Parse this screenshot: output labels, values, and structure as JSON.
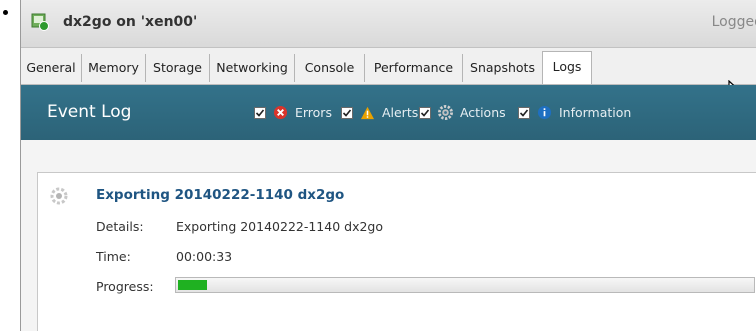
{
  "window": {
    "title": "dx2go on 'xen00'",
    "logged_in_text": "Logged"
  },
  "tabs": [
    {
      "label": "General"
    },
    {
      "label": "Memory"
    },
    {
      "label": "Storage"
    },
    {
      "label": "Networking"
    },
    {
      "label": "Console"
    },
    {
      "label": "Performance"
    },
    {
      "label": "Snapshots"
    },
    {
      "label": "Logs",
      "active": true
    }
  ],
  "event_log": {
    "title": "Event Log",
    "filters": [
      {
        "label": "Errors",
        "checked": true,
        "icon": "error-icon",
        "color": "#d9342b"
      },
      {
        "label": "Alerts",
        "checked": true,
        "icon": "alert-icon",
        "color": "#e8a100"
      },
      {
        "label": "Actions",
        "checked": true,
        "icon": "gear-icon",
        "color": "#c0c0c0"
      },
      {
        "label": "Information",
        "checked": true,
        "icon": "info-icon",
        "color": "#1e6fc1"
      }
    ]
  },
  "event": {
    "title": "Exporting 20140222-1140 dx2go",
    "details_label": "Details:",
    "details_value": "Exporting 20140222-1140 dx2go",
    "time_label": "Time:",
    "time_value": "00:00:33",
    "progress_label": "Progress:",
    "progress_fraction": 0.05
  },
  "colors": {
    "header_bar": "#2f6b82",
    "progress_green": "#1fb121",
    "event_title": "#1f5582"
  }
}
